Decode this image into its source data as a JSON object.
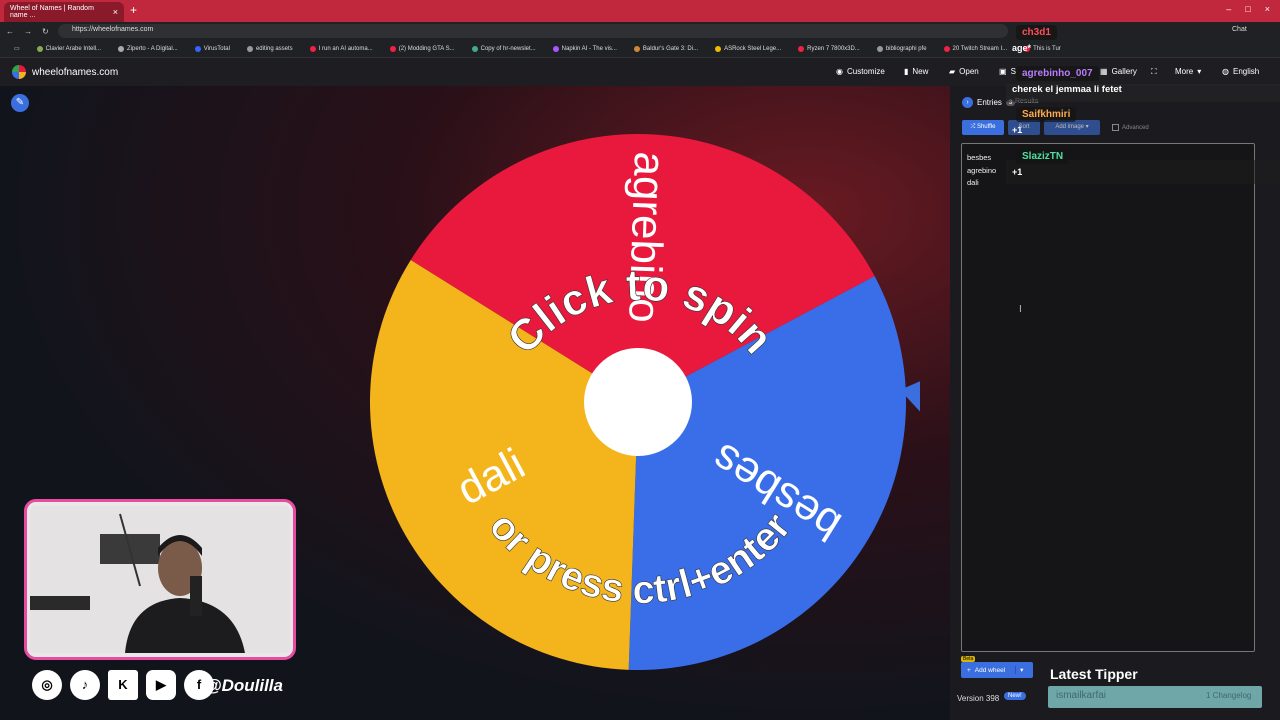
{
  "browser": {
    "tab_title": "Wheel of Names | Random name ...",
    "tab_close": "×",
    "new_tab": "+",
    "window_controls": [
      "–",
      "□",
      "×"
    ],
    "url": "https://wheelofnames.com",
    "bookmarks": [
      "Clavier Arabe Intell...",
      "Ziperto - A Digital...",
      "VirusTotal",
      "editing assets",
      "I run an AI automa...",
      "(2) Modding GTA S...",
      "Copy of hr-newslet...",
      "Napkin AI - The vis...",
      "Baldur's Gate 3: Di...",
      "ASRock Steel Lege...",
      "Ryzen 7 7800x3D...",
      "bibliographi pfe",
      "20 Twitch Stream I...",
      "This is Tur"
    ],
    "chat_label": "Chat"
  },
  "nav": {
    "site_name": "wheelofnames.com",
    "customize": "Customize",
    "new": "New",
    "open": "Open",
    "save": "S",
    "gallery": "Gallery",
    "more": "More",
    "language": "English"
  },
  "wheel": {
    "slices": [
      {
        "label": "agrebino",
        "color": "#e8193c"
      },
      {
        "label": "besbes",
        "color": "#3a6ee8"
      },
      {
        "label": "dali",
        "color": "#f3b51b"
      }
    ],
    "overlay_top": "Click to spin",
    "overlay_bottom": "or press ctrl+enter"
  },
  "panel": {
    "entries_label": "Entries",
    "entries_count": "3",
    "results_label": "Results",
    "shuffle": "Shuffle",
    "sort": "Sort",
    "add_image": "Add image",
    "advanced": "Advanced",
    "entries_text": "besbes\nagrebino\ndali",
    "beta": "Beta",
    "add_wheel": "Add wheel",
    "version": "Version 398",
    "new_badge": "New!"
  },
  "chat": {
    "user1": "ch3d1",
    "msg1": "age*",
    "user2": "agrebinho_007",
    "msg2": "cherek el jemmaa li fetet",
    "user3": "Saifkhmiri",
    "msg3": "+1",
    "user4": "SlazizTN",
    "msg4": "+1"
  },
  "socials": {
    "icons": [
      "instagram-icon",
      "tiktok-icon",
      "kick-icon",
      "youtube-icon",
      "facebook-icon"
    ],
    "handle": "@Doulilla"
  },
  "tipper": {
    "title": "Latest Tipper",
    "name": "ismailkarfai",
    "amount": "1 Changelog"
  },
  "colors": {
    "accent": "#3b6fe0",
    "titlebar": "#c1283e",
    "webcam_border": "#e94ba0"
  }
}
